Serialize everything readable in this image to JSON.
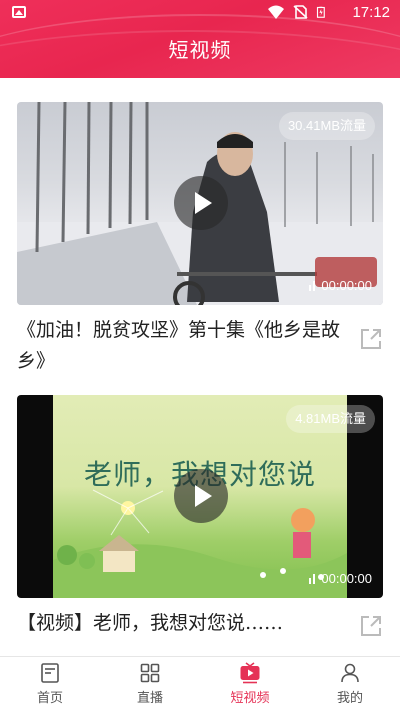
{
  "status_bar": {
    "time": "17:12"
  },
  "header": {
    "title": "短视频"
  },
  "videos": [
    {
      "size_label": "30.41MB流量",
      "duration": "00:00:00",
      "title": "《加油！脱贫攻坚》第十集《他乡是故乡》"
    },
    {
      "size_label": "4.81MB流量",
      "duration": "00:00:00",
      "title": "【视频】老师，我想对您说……",
      "scene_text": "老师，我想对您说"
    }
  ],
  "tabs": [
    {
      "label": "首页",
      "icon": "home-icon"
    },
    {
      "label": "直播",
      "icon": "grid-icon"
    },
    {
      "label": "短视频",
      "icon": "play-video-icon"
    },
    {
      "label": "我的",
      "icon": "person-icon"
    }
  ],
  "active_tab": "短视频",
  "colors": {
    "accent": "#e53256",
    "header": "#e8264f"
  }
}
